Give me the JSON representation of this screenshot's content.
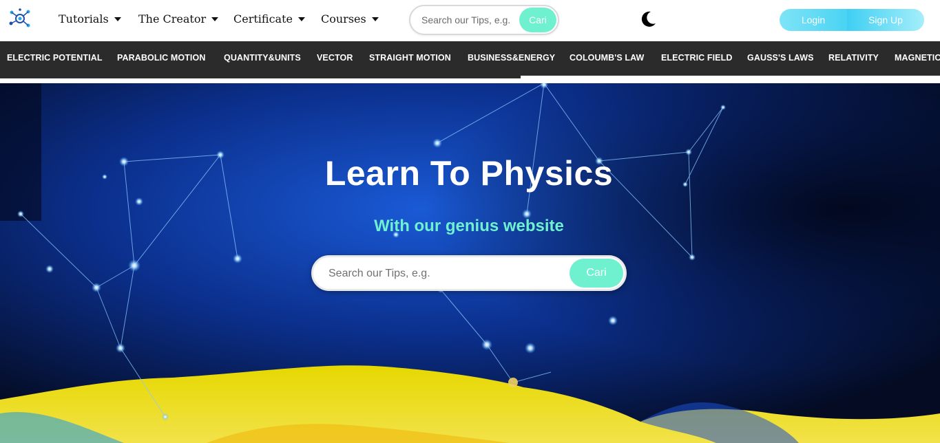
{
  "header": {
    "nav": [
      {
        "label": "Tutorials"
      },
      {
        "label": "The Creator"
      },
      {
        "label": "Certificate"
      },
      {
        "label": "Courses"
      }
    ],
    "search": {
      "placeholder": "Search our Tips, e.g.",
      "button": "Cari"
    },
    "theme_icon": "moon-icon",
    "login": "Login",
    "signup": "Sign Up"
  },
  "topics": [
    "ELECTRIC POTENTIAL",
    "PARABOLIC MOTION",
    "QUANTITY&UNITS",
    "VECTOR",
    "STRAIGHT MOTION",
    "BUSINESS&ENERGY",
    "COLOUMB'S LAW",
    "ELECTRIC FIELD",
    "GAUSS'S LAWS",
    "RELATIVITY",
    "MAGNETIC"
  ],
  "hero": {
    "title": "Learn To Physics",
    "subtitle": "With our genius website",
    "search": {
      "placeholder": "Search our Tips, e.g.",
      "button": "Cari"
    }
  },
  "colors": {
    "accent": "#6ff0cf",
    "topic_bar": "#2b2b2b",
    "button_blue": "#4ad3f3"
  }
}
